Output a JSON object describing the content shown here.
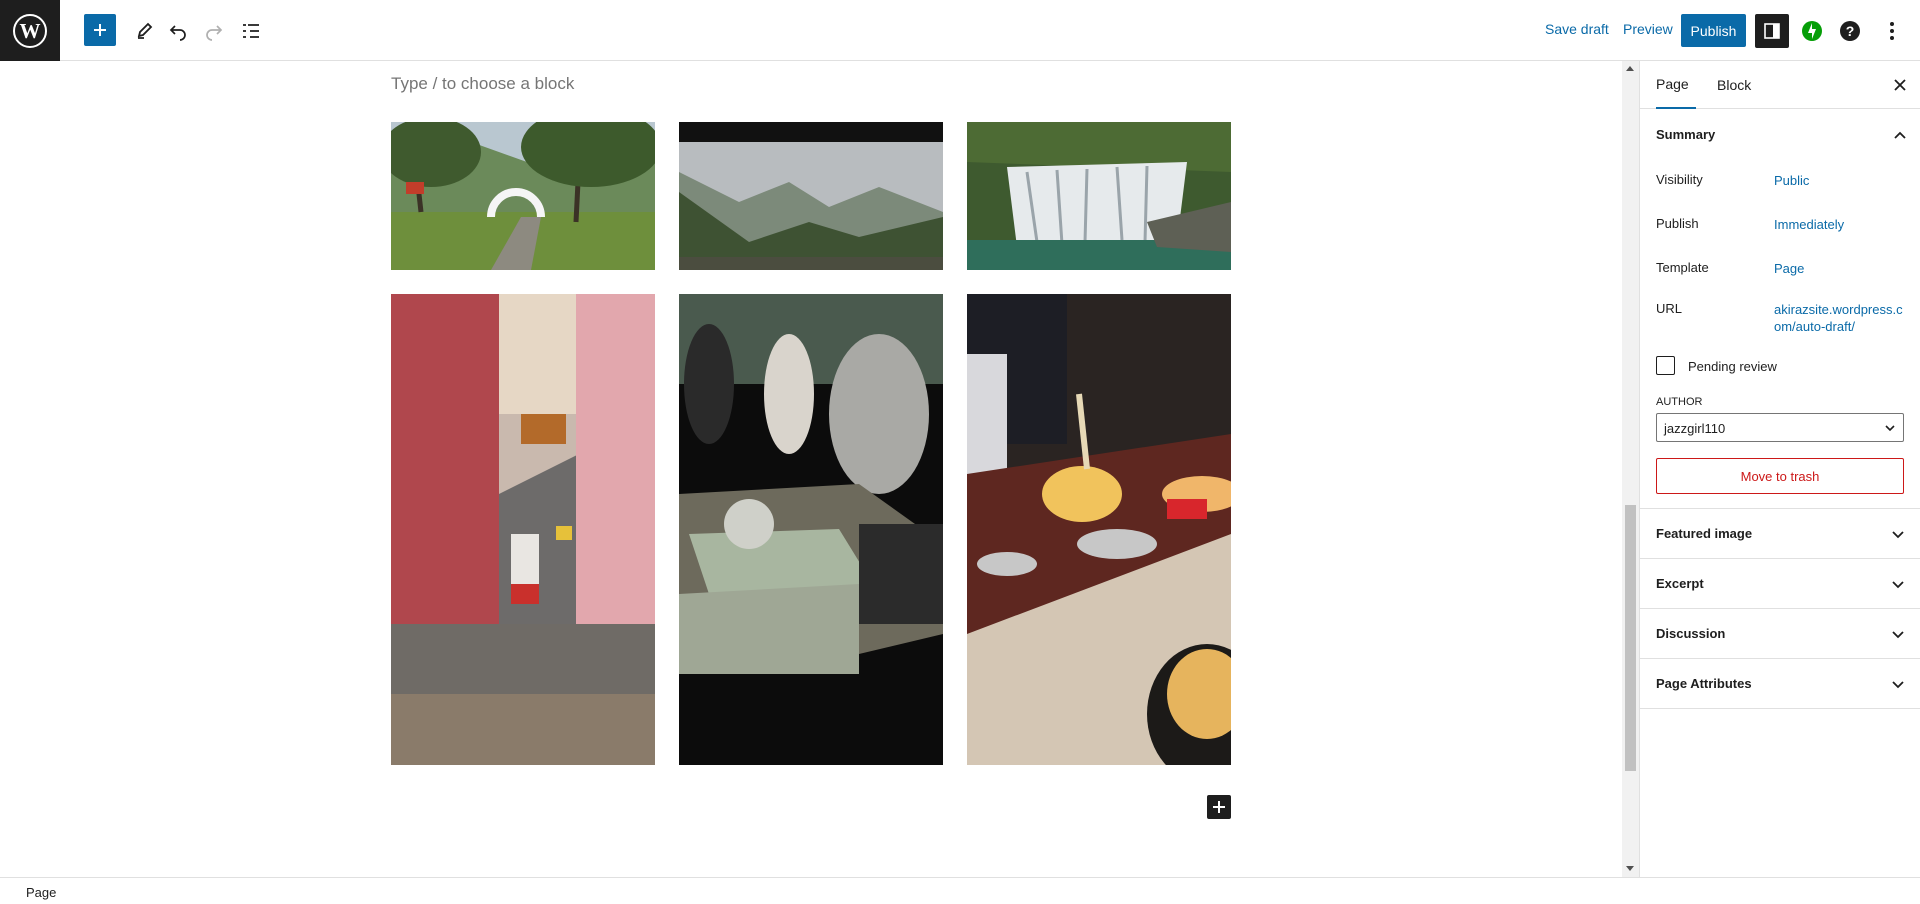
{
  "toolbar": {
    "save_draft": "Save draft",
    "preview": "Preview",
    "publish": "Publish"
  },
  "editor": {
    "placeholder": "Type / to choose a block"
  },
  "sidebar": {
    "tabs": [
      "Page",
      "Block"
    ],
    "summary": {
      "title": "Summary",
      "visibility_label": "Visibility",
      "visibility_value": "Public",
      "publish_label": "Publish",
      "publish_value": "Immediately",
      "template_label": "Template",
      "template_value": "Page",
      "url_label": "URL",
      "url_value_line1": "akirazsite.wordpress.c",
      "url_value_line2": "om/auto-draft/",
      "pending_review": "Pending review",
      "author_label": "AUTHOR",
      "author_value": "jazzgirl110",
      "trash": "Move to trash"
    },
    "panels": [
      "Featured image",
      "Excerpt",
      "Discussion",
      "Page Attributes"
    ]
  },
  "footer": {
    "breadcrumb": "Page"
  },
  "colors": {
    "accent": "#0a6aa8",
    "dark": "#1e1e1e",
    "danger": "#cc1818",
    "jetpack": "#069e08"
  }
}
